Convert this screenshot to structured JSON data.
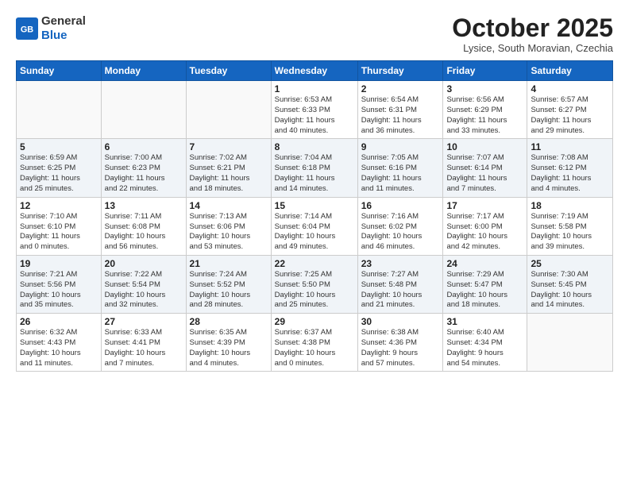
{
  "header": {
    "logo_general": "General",
    "logo_blue": "Blue",
    "month": "October 2025",
    "location": "Lysice, South Moravian, Czechia"
  },
  "weekdays": [
    "Sunday",
    "Monday",
    "Tuesday",
    "Wednesday",
    "Thursday",
    "Friday",
    "Saturday"
  ],
  "weeks": [
    [
      {
        "day": "",
        "info": ""
      },
      {
        "day": "",
        "info": ""
      },
      {
        "day": "",
        "info": ""
      },
      {
        "day": "1",
        "info": "Sunrise: 6:53 AM\nSunset: 6:33 PM\nDaylight: 11 hours\nand 40 minutes."
      },
      {
        "day": "2",
        "info": "Sunrise: 6:54 AM\nSunset: 6:31 PM\nDaylight: 11 hours\nand 36 minutes."
      },
      {
        "day": "3",
        "info": "Sunrise: 6:56 AM\nSunset: 6:29 PM\nDaylight: 11 hours\nand 33 minutes."
      },
      {
        "day": "4",
        "info": "Sunrise: 6:57 AM\nSunset: 6:27 PM\nDaylight: 11 hours\nand 29 minutes."
      }
    ],
    [
      {
        "day": "5",
        "info": "Sunrise: 6:59 AM\nSunset: 6:25 PM\nDaylight: 11 hours\nand 25 minutes."
      },
      {
        "day": "6",
        "info": "Sunrise: 7:00 AM\nSunset: 6:23 PM\nDaylight: 11 hours\nand 22 minutes."
      },
      {
        "day": "7",
        "info": "Sunrise: 7:02 AM\nSunset: 6:21 PM\nDaylight: 11 hours\nand 18 minutes."
      },
      {
        "day": "8",
        "info": "Sunrise: 7:04 AM\nSunset: 6:18 PM\nDaylight: 11 hours\nand 14 minutes."
      },
      {
        "day": "9",
        "info": "Sunrise: 7:05 AM\nSunset: 6:16 PM\nDaylight: 11 hours\nand 11 minutes."
      },
      {
        "day": "10",
        "info": "Sunrise: 7:07 AM\nSunset: 6:14 PM\nDaylight: 11 hours\nand 7 minutes."
      },
      {
        "day": "11",
        "info": "Sunrise: 7:08 AM\nSunset: 6:12 PM\nDaylight: 11 hours\nand 4 minutes."
      }
    ],
    [
      {
        "day": "12",
        "info": "Sunrise: 7:10 AM\nSunset: 6:10 PM\nDaylight: 11 hours\nand 0 minutes."
      },
      {
        "day": "13",
        "info": "Sunrise: 7:11 AM\nSunset: 6:08 PM\nDaylight: 10 hours\nand 56 minutes."
      },
      {
        "day": "14",
        "info": "Sunrise: 7:13 AM\nSunset: 6:06 PM\nDaylight: 10 hours\nand 53 minutes."
      },
      {
        "day": "15",
        "info": "Sunrise: 7:14 AM\nSunset: 6:04 PM\nDaylight: 10 hours\nand 49 minutes."
      },
      {
        "day": "16",
        "info": "Sunrise: 7:16 AM\nSunset: 6:02 PM\nDaylight: 10 hours\nand 46 minutes."
      },
      {
        "day": "17",
        "info": "Sunrise: 7:17 AM\nSunset: 6:00 PM\nDaylight: 10 hours\nand 42 minutes."
      },
      {
        "day": "18",
        "info": "Sunrise: 7:19 AM\nSunset: 5:58 PM\nDaylight: 10 hours\nand 39 minutes."
      }
    ],
    [
      {
        "day": "19",
        "info": "Sunrise: 7:21 AM\nSunset: 5:56 PM\nDaylight: 10 hours\nand 35 minutes."
      },
      {
        "day": "20",
        "info": "Sunrise: 7:22 AM\nSunset: 5:54 PM\nDaylight: 10 hours\nand 32 minutes."
      },
      {
        "day": "21",
        "info": "Sunrise: 7:24 AM\nSunset: 5:52 PM\nDaylight: 10 hours\nand 28 minutes."
      },
      {
        "day": "22",
        "info": "Sunrise: 7:25 AM\nSunset: 5:50 PM\nDaylight: 10 hours\nand 25 minutes."
      },
      {
        "day": "23",
        "info": "Sunrise: 7:27 AM\nSunset: 5:48 PM\nDaylight: 10 hours\nand 21 minutes."
      },
      {
        "day": "24",
        "info": "Sunrise: 7:29 AM\nSunset: 5:47 PM\nDaylight: 10 hours\nand 18 minutes."
      },
      {
        "day": "25",
        "info": "Sunrise: 7:30 AM\nSunset: 5:45 PM\nDaylight: 10 hours\nand 14 minutes."
      }
    ],
    [
      {
        "day": "26",
        "info": "Sunrise: 6:32 AM\nSunset: 4:43 PM\nDaylight: 10 hours\nand 11 minutes."
      },
      {
        "day": "27",
        "info": "Sunrise: 6:33 AM\nSunset: 4:41 PM\nDaylight: 10 hours\nand 7 minutes."
      },
      {
        "day": "28",
        "info": "Sunrise: 6:35 AM\nSunset: 4:39 PM\nDaylight: 10 hours\nand 4 minutes."
      },
      {
        "day": "29",
        "info": "Sunrise: 6:37 AM\nSunset: 4:38 PM\nDaylight: 10 hours\nand 0 minutes."
      },
      {
        "day": "30",
        "info": "Sunrise: 6:38 AM\nSunset: 4:36 PM\nDaylight: 9 hours\nand 57 minutes."
      },
      {
        "day": "31",
        "info": "Sunrise: 6:40 AM\nSunset: 4:34 PM\nDaylight: 9 hours\nand 54 minutes."
      },
      {
        "day": "",
        "info": ""
      }
    ]
  ]
}
